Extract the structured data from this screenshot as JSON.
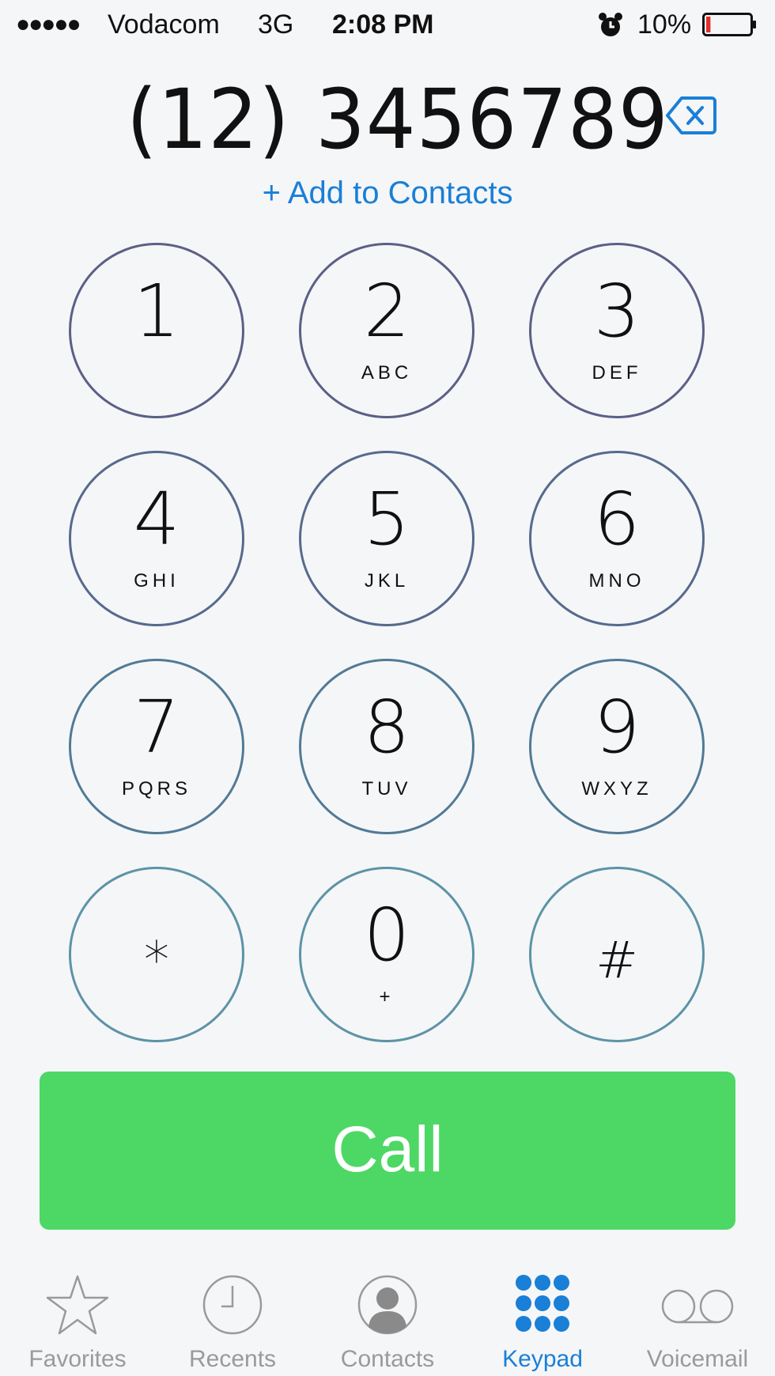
{
  "status_bar": {
    "signal": "●●●●●",
    "carrier": "Vodacom",
    "network": "3G",
    "time": "2:08 PM",
    "battery_percent": "10%",
    "alarm_icon": "alarm-clock-icon",
    "battery_icon": "battery-low-icon",
    "battery_level": 0.1,
    "battery_color": "#e0302a"
  },
  "dialer": {
    "number": "(12) 3456789",
    "delete_icon": "backspace-icon",
    "add_to_contacts": "+ Add to Contacts"
  },
  "keypad": {
    "keys": [
      {
        "digit": "1",
        "letters": ""
      },
      {
        "digit": "2",
        "letters": "ABC"
      },
      {
        "digit": "3",
        "letters": "DEF"
      },
      {
        "digit": "4",
        "letters": "GHI"
      },
      {
        "digit": "5",
        "letters": "JKL"
      },
      {
        "digit": "6",
        "letters": "MNO"
      },
      {
        "digit": "7",
        "letters": "PQRS"
      },
      {
        "digit": "8",
        "letters": "TUV"
      },
      {
        "digit": "9",
        "letters": "WXYZ"
      },
      {
        "digit": "*",
        "letters": ""
      },
      {
        "digit": "0",
        "letters": "+"
      },
      {
        "digit": "#",
        "letters": ""
      }
    ]
  },
  "call": {
    "label": "Call",
    "color": "#4dd865"
  },
  "tabs": [
    {
      "label": "Favorites",
      "icon": "star-icon",
      "active": false
    },
    {
      "label": "Recents",
      "icon": "clock-icon",
      "active": false
    },
    {
      "label": "Contacts",
      "icon": "person-icon",
      "active": false
    },
    {
      "label": "Keypad",
      "icon": "keypad-icon",
      "active": true
    },
    {
      "label": "Voicemail",
      "icon": "voicemail-icon",
      "active": false
    }
  ],
  "colors": {
    "accent": "#1a7fd6",
    "inactive": "#9a9a9a"
  }
}
